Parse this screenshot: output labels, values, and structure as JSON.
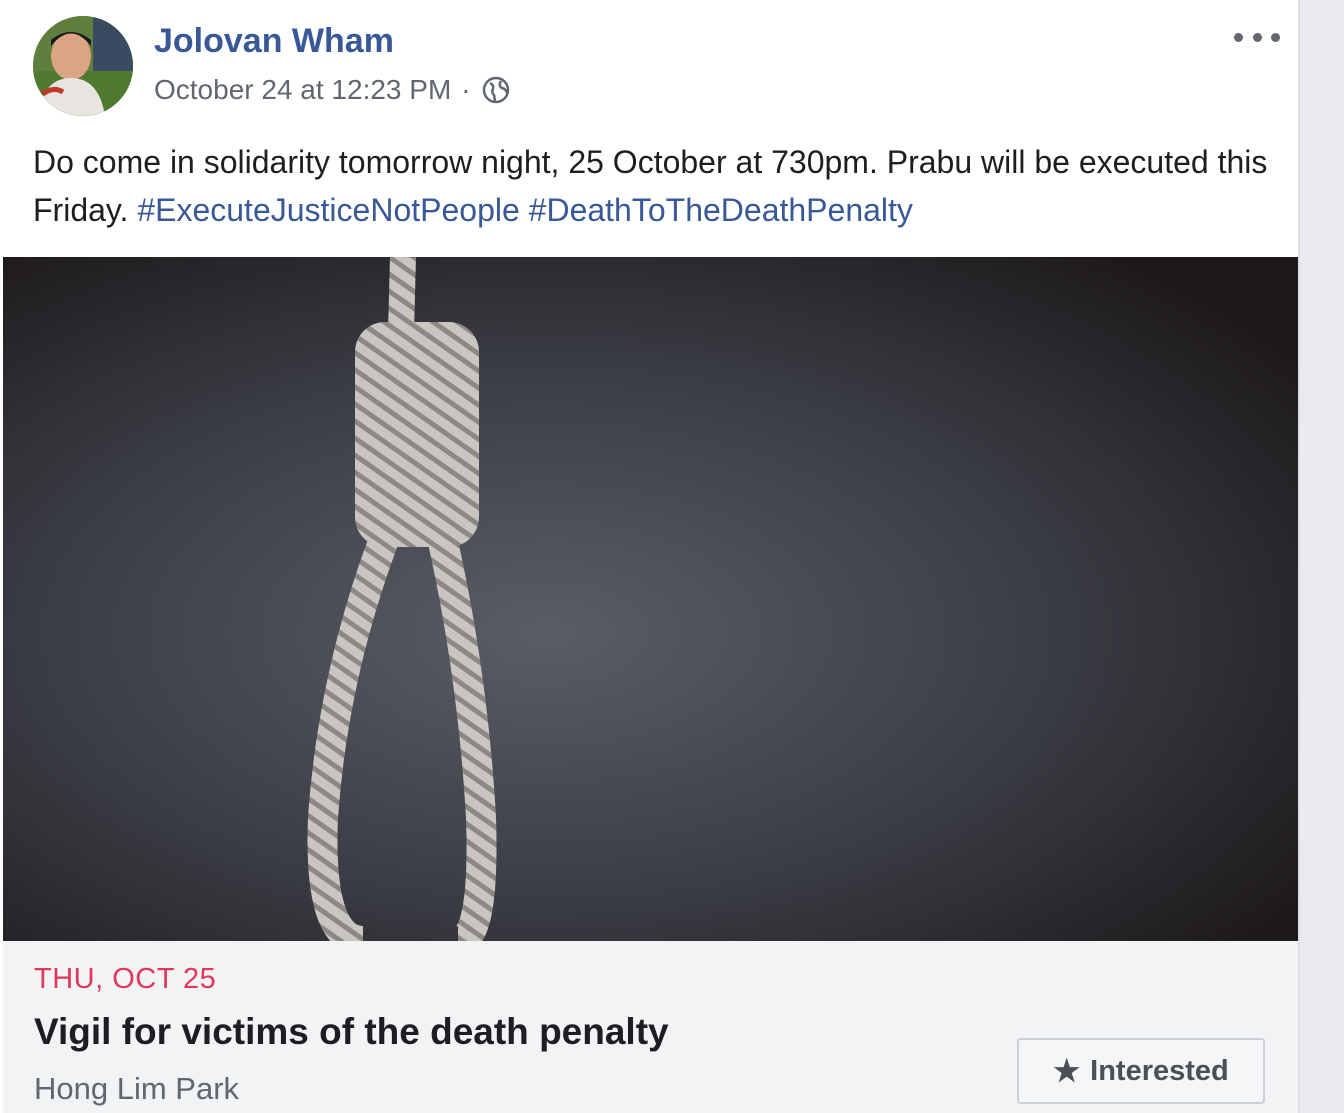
{
  "post": {
    "author": "Jolovan Wham",
    "timestamp": "October 24 at 12:23 PM",
    "separator": "·",
    "privacy_icon": "globe-icon",
    "more_icon": "more-options-icon",
    "body_text": "Do come in solidarity tomorrow night, 25 October at 730pm. Prabu will be executed this Friday.",
    "hashtags": [
      "#ExecuteJusticeNotPeople",
      "#DeathToTheDeathPenalty"
    ]
  },
  "event": {
    "date": "THU, OCT 25",
    "title": "Vigil for victims of the death penalty",
    "location": "Hong Lim Park",
    "interested_label": "Interested",
    "interested_icon": "star-icon"
  },
  "colors": {
    "link": "#385898",
    "date_accent": "#e0375b",
    "text": "#1c1e21",
    "secondary": "#616770"
  }
}
